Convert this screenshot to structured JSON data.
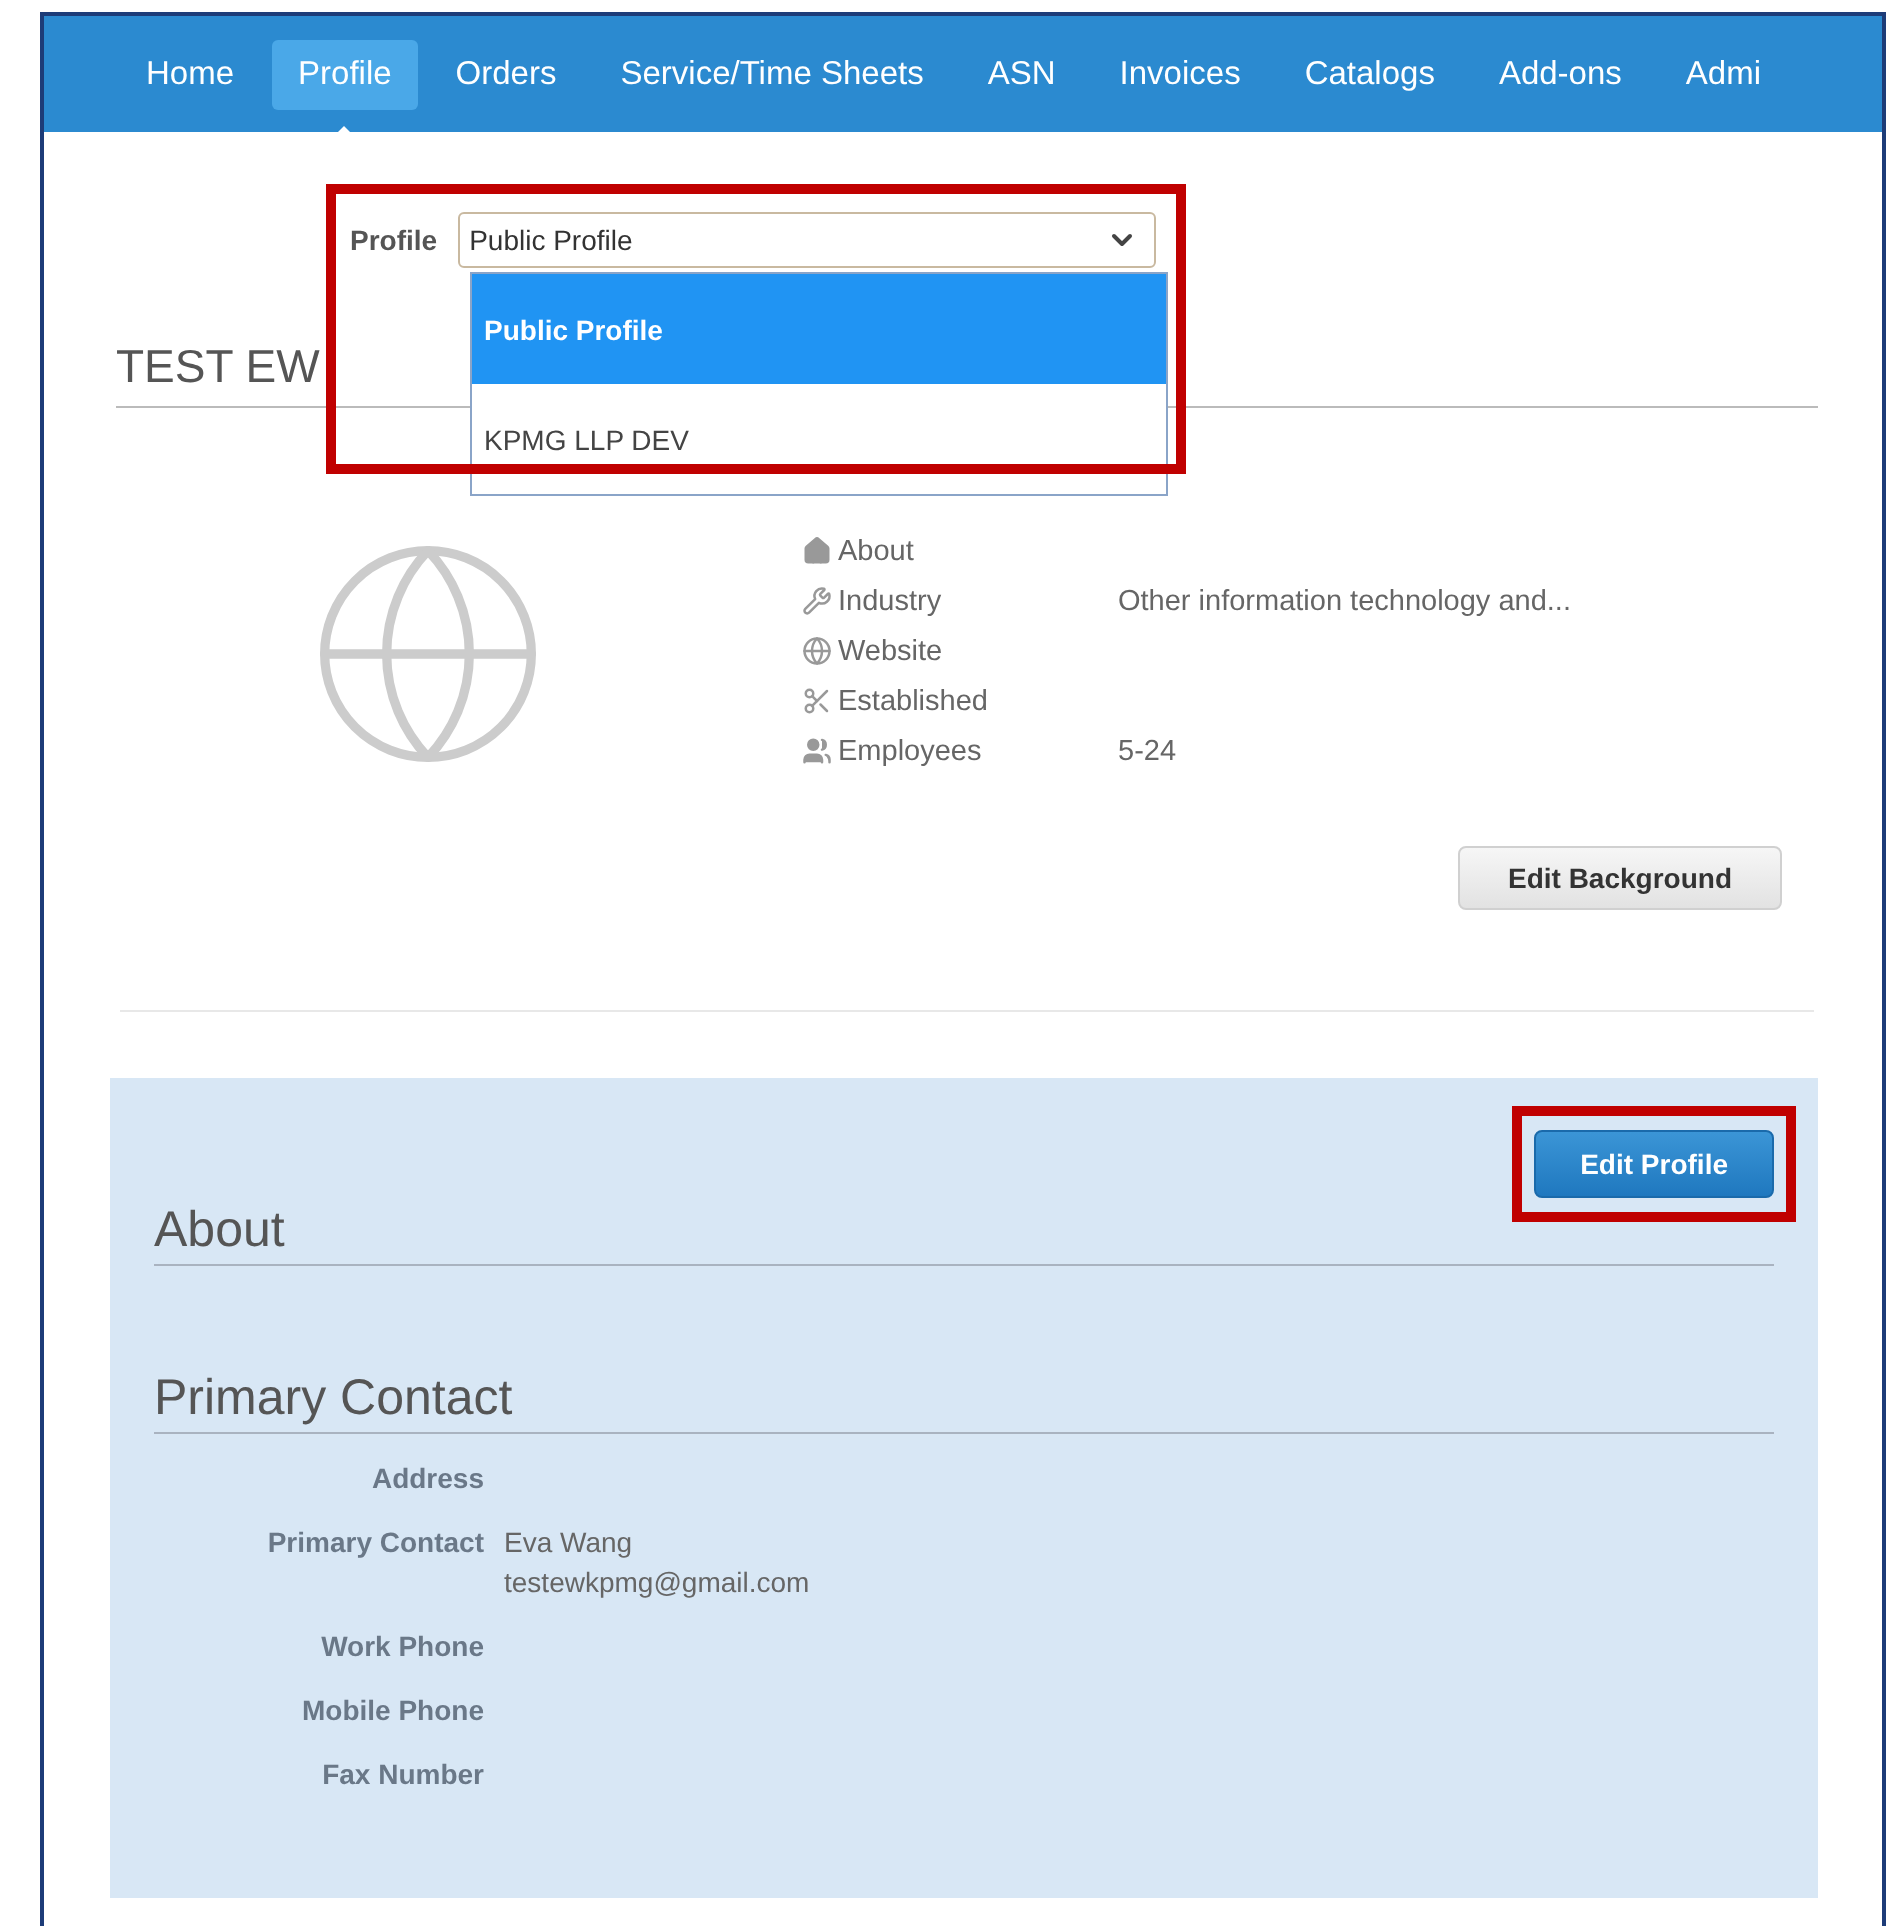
{
  "nav": [
    {
      "label": "Home",
      "selected": false
    },
    {
      "label": "Profile",
      "selected": true
    },
    {
      "label": "Orders",
      "selected": false
    },
    {
      "label": "Service/Time Sheets",
      "selected": false
    },
    {
      "label": "ASN",
      "selected": false
    },
    {
      "label": "Invoices",
      "selected": false
    },
    {
      "label": "Catalogs",
      "selected": false
    },
    {
      "label": "Add-ons",
      "selected": false
    },
    {
      "label": "Admi",
      "selected": false
    }
  ],
  "profile_selector": {
    "label": "Profile",
    "value": "Public Profile",
    "expanded": true,
    "highlighted": true,
    "options": [
      {
        "label": "Public Profile",
        "selected": true
      },
      {
        "label": "KPMG LLP DEV",
        "selected": false
      }
    ]
  },
  "company": {
    "name": "TEST EW",
    "details": [
      {
        "kind": "about",
        "label": "About"
      },
      {
        "kind": "industry",
        "label": "Industry",
        "value": "Other information technology and..."
      },
      {
        "kind": "website",
        "label": "Website"
      },
      {
        "kind": "established",
        "label": "Established"
      },
      {
        "kind": "employees",
        "label": "Employees",
        "value": "5-24"
      }
    ],
    "edit_button": "Edit Background"
  },
  "panel": {
    "edit_button": {
      "label": "Edit Profile",
      "highlighted": true
    },
    "about_heading": "About",
    "contact_heading": "Primary Contact",
    "fields": [
      {
        "label": "Address"
      },
      {
        "label": "Primary Contact",
        "values": [
          "Eva Wang",
          "testewkpmg@gmail.com"
        ]
      },
      {
        "label": "Work Phone"
      },
      {
        "label": "Mobile Phone"
      },
      {
        "label": "Fax Number"
      }
    ]
  }
}
